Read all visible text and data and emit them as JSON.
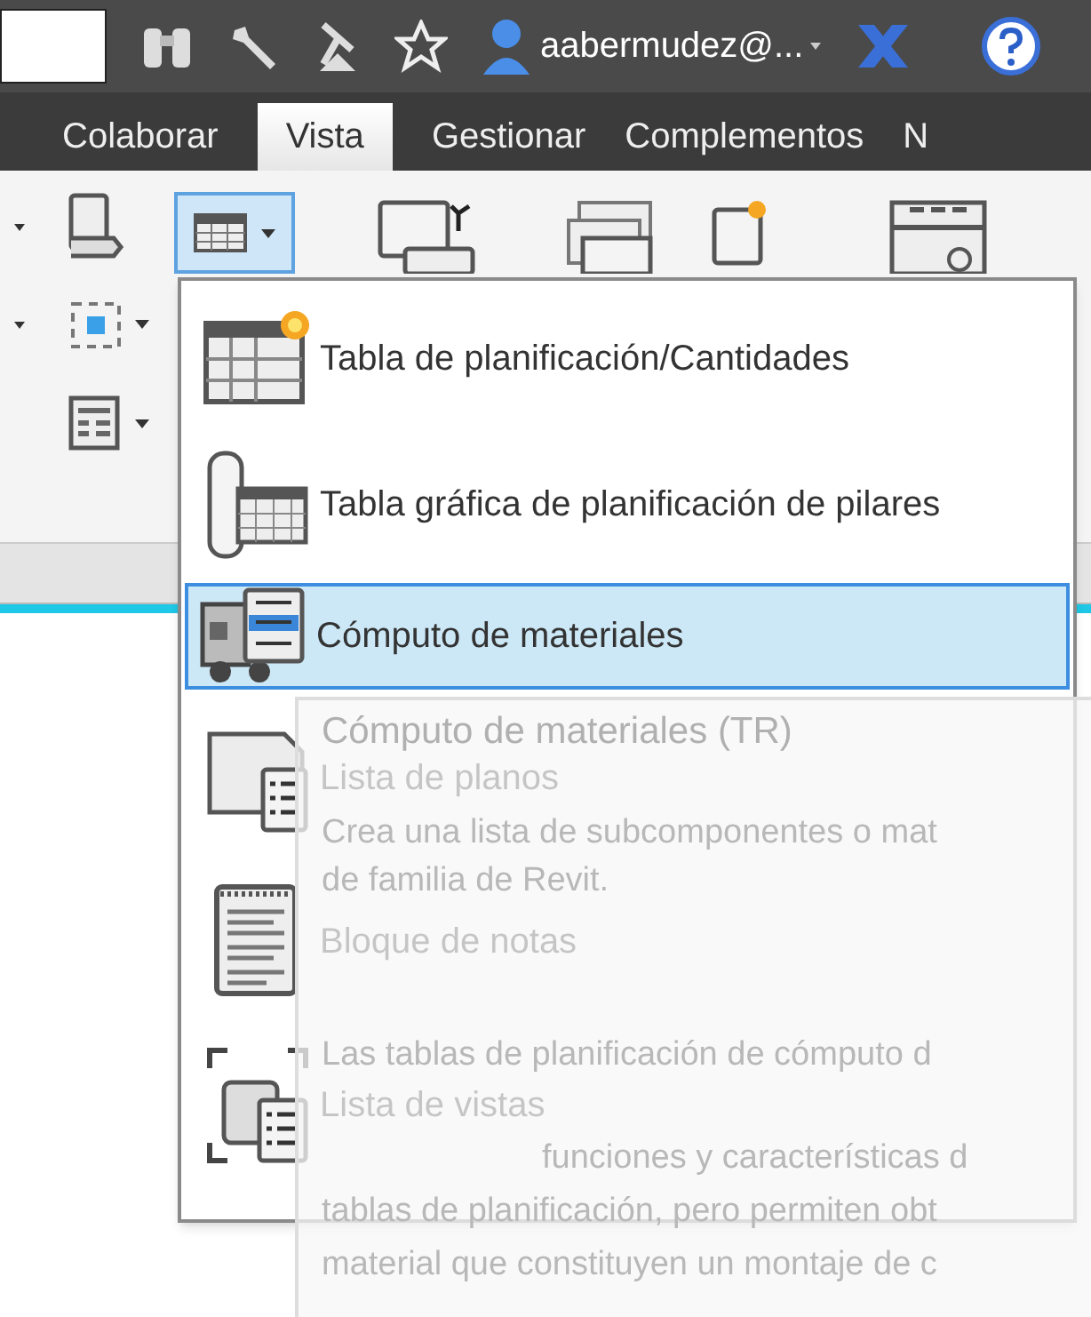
{
  "title_bar": {
    "user": "aabermudez@..."
  },
  "tabs": [
    {
      "label": "Colaborar",
      "selected": false
    },
    {
      "label": "Vista",
      "selected": true
    },
    {
      "label": "Gestionar",
      "selected": false
    },
    {
      "label": "Complementos",
      "selected": false
    },
    {
      "label": "N",
      "selected": false
    }
  ],
  "menu": [
    {
      "label": "Tabla de planificación/Cantidades",
      "selected": false
    },
    {
      "label": "Tabla gráfica de planificación de pilares",
      "selected": false
    },
    {
      "label": "Cómputo de materiales",
      "selected": true
    },
    {
      "label": "Lista de planos",
      "selected": false
    },
    {
      "label": "Bloque de notas",
      "selected": false
    },
    {
      "label": "Lista de vistas",
      "selected": false
    }
  ],
  "tooltip": {
    "title": "Cómputo de materiales (TR)",
    "lines": [
      "Crea una lista de subcomponentes o mat",
      "de familia de Revit.",
      "Las tablas de planificación de cómputo d",
      "funciones y características d",
      "tablas de planificación, pero permiten obt",
      "material que constituyen un montaje de c"
    ]
  }
}
